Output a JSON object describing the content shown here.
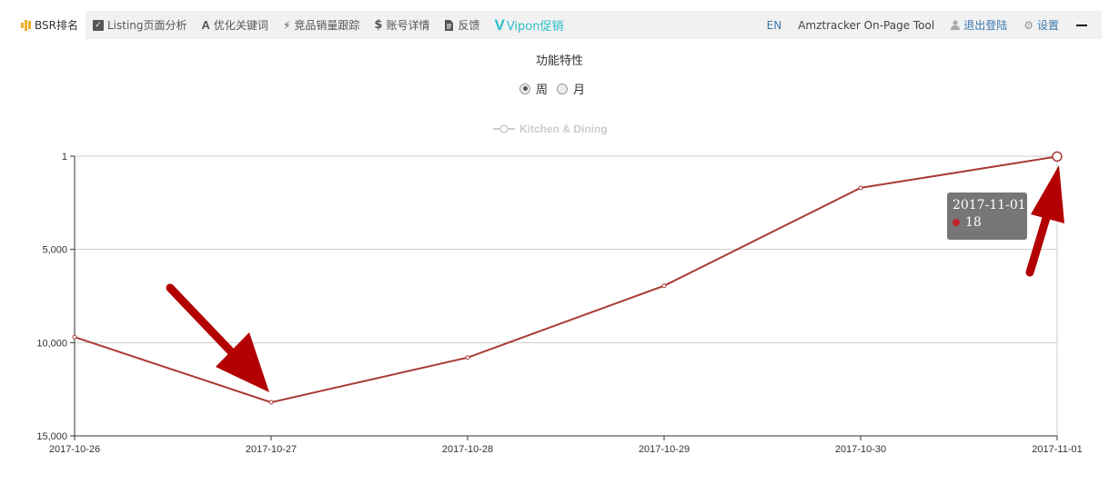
{
  "nav": {
    "items": [
      {
        "label": "BSR排名",
        "icon": "bar-chart-icon"
      },
      {
        "label": "Listing页面分析",
        "icon": "checkbox-icon"
      },
      {
        "label": "优化关键词",
        "icon": "letter-a-icon"
      },
      {
        "label": "竞品销量跟踪",
        "icon": "lightning-icon"
      },
      {
        "label": "账号详情",
        "icon": "dollar-icon"
      },
      {
        "label": "反馈",
        "icon": "document-icon"
      },
      {
        "label": "Vipon促销",
        "icon": "vipon-logo-icon"
      }
    ],
    "right": {
      "language": "EN",
      "tool_name": "Amztracker On-Page Tool",
      "logout": "退出登陆",
      "settings": "设置"
    }
  },
  "chart_header": {
    "title": "功能特性",
    "radio_week": "周",
    "radio_month": "月",
    "selected": "周"
  },
  "tooltip": {
    "date": "2017-11-01",
    "value": "18"
  },
  "colors": {
    "line": "#a83a35",
    "accent_vipon": "#2bbec8",
    "link": "#3a7ab0"
  },
  "chart_data": {
    "type": "line",
    "legend": "Kitchen & Dining",
    "legend_position": "top-center",
    "x": [
      "2017-10-26",
      "2017-10-27",
      "2017-10-28",
      "2017-10-29",
      "2017-10-30",
      "2017-11-01"
    ],
    "series": [
      {
        "name": "Kitchen & Dining",
        "values": [
          9700,
          13200,
          10800,
          6950,
          1700,
          18
        ]
      }
    ],
    "y_ticks": [
      1,
      5000,
      10000,
      15000
    ],
    "y_tick_labels": [
      "1",
      "5,000",
      "10,000",
      "15,000"
    ],
    "ylim": [
      1,
      15000
    ],
    "y_inverted": true,
    "grid": true
  }
}
